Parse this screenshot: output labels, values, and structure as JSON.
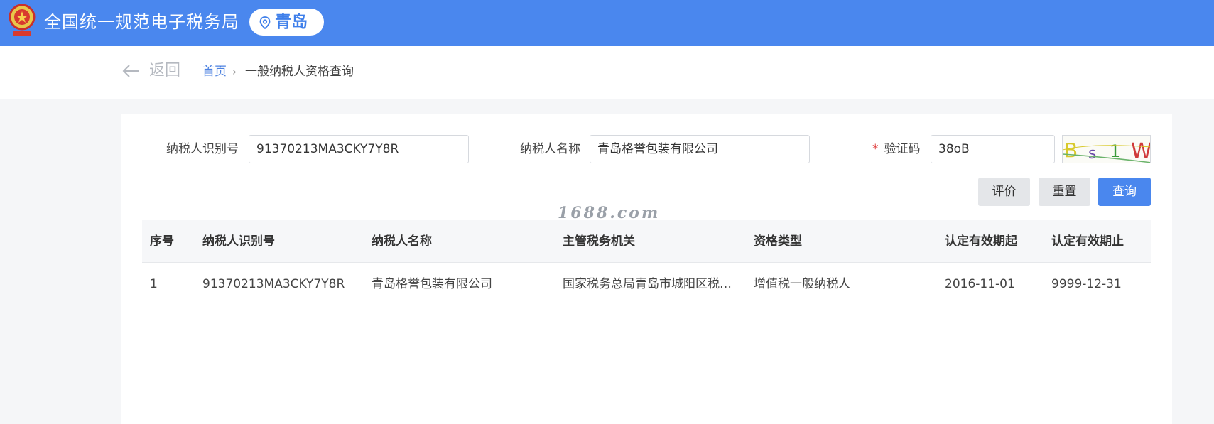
{
  "header": {
    "title": "全国统一规范电子税务局",
    "city": "青岛",
    "emblem_icon": "national-emblem-icon",
    "pin_icon": "location-pin-icon"
  },
  "breadcrumb": {
    "back_label": "返回",
    "home": "首页",
    "separator": "›",
    "current": "一般纳税人资格查询"
  },
  "form": {
    "taxpayer_id_label": "纳税人识别号",
    "taxpayer_id_value": "91370213MA3CKY7Y8R",
    "taxpayer_name_label": "纳税人名称",
    "taxpayer_name_value": "青岛格誉包装有限公司",
    "captcha_required_mark": "*",
    "captcha_label": "验证码",
    "captcha_value": "38oB",
    "captcha_chars": [
      "B",
      "s",
      "1",
      "W"
    ]
  },
  "buttons": {
    "evaluate": "评价",
    "reset": "重置",
    "query": "查询"
  },
  "watermark": "1688.com",
  "table": {
    "columns": [
      "序号",
      "纳税人识别号",
      "纳税人名称",
      "主管税务机关",
      "资格类型",
      "认定有效期起",
      "认定有效期止"
    ],
    "rows": [
      [
        "1",
        "91370213MA3CKY7Y8R",
        "青岛格誉包装有限公司",
        "国家税务总局青岛市城阳区税…",
        "增值税一般纳税人",
        "2016-11-01",
        "9999-12-31"
      ]
    ]
  },
  "colors": {
    "header_blue": "#4a87ee",
    "link_blue": "#4d82e0",
    "required_red": "#e04040"
  }
}
